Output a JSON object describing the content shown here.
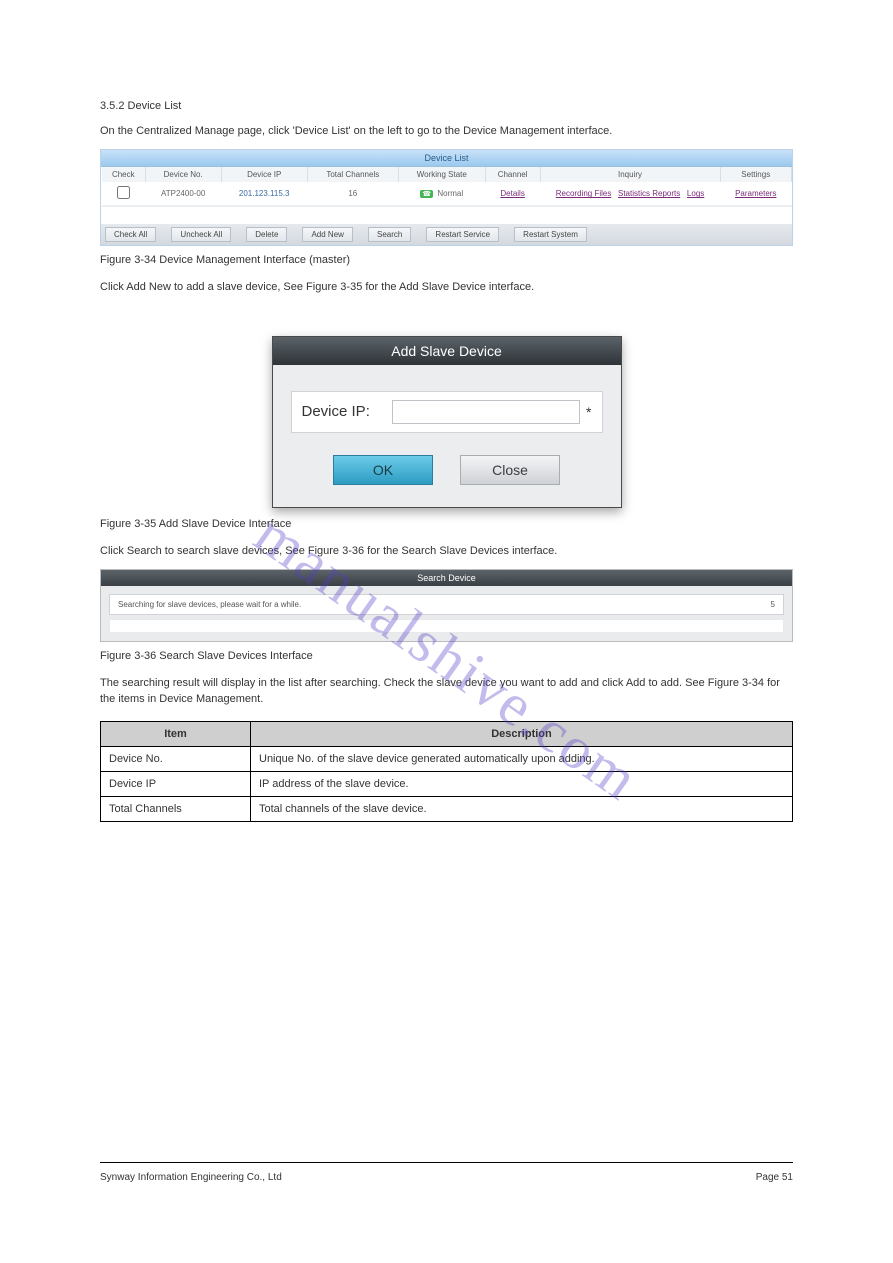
{
  "watermark": "manualshive.com",
  "heading_top": "3.5.2 Device List",
  "intro_text": "On the Centralized Manage page, click 'Device List' on the left to go to the Device Management interface.",
  "device_list": {
    "title": "Device List",
    "headers": [
      "Check",
      "Device No.",
      "Device IP",
      "Total Channels",
      "Working State",
      "Channel",
      "Inquiry",
      "Settings"
    ],
    "row": {
      "device_no": "ATP2400-00",
      "device_ip": "201.123.115.3",
      "total_channels": "16",
      "state_text": "Normal",
      "channel_link": "Details",
      "inquiry_files": "Recording Files",
      "inquiry_stats": "Statistics Reports",
      "inquiry_logs": "Logs",
      "settings_link": "Parameters"
    },
    "buttons": [
      "Check All",
      "Uncheck All",
      "Delete",
      "Add New",
      "Search",
      "Restart Service",
      "Restart System"
    ]
  },
  "fig1_caption": "Figure 3-34 Device Management Interface (master)",
  "add_new_text": "Click Add New to add a slave device, See Figure 3-35 for the Add Slave Device interface.",
  "dialog": {
    "title": "Add Slave Device",
    "label": "Device IP:",
    "star": "*",
    "ok": "OK",
    "close": "Close"
  },
  "fig2_caption": "Figure 3-35 Add Slave Device Interface",
  "search_text": "Click Search to search slave devices, See Figure 3-36 for the Search Slave Devices interface.",
  "search_panel": {
    "title": "Search Device",
    "body": "Searching for slave devices, please wait for a while.",
    "counter": "5"
  },
  "fig3_caption": "Figure 3-36 Search Slave Devices Interface",
  "result_text": "The searching result will display in the list after searching. Check the slave device you want to add and click Add to add. See Figure 3-34 for the items in Device Management.",
  "items_table": {
    "headers": [
      "Item",
      "Description"
    ],
    "rows": [
      [
        "Device No.",
        "Unique No. of the slave device generated automatically upon adding."
      ],
      [
        "Device IP",
        "IP address of the slave device."
      ],
      [
        "Total Channels",
        "Total channels of the slave device."
      ]
    ]
  },
  "footer": {
    "left": "Synway Information Engineering Co., Ltd",
    "right": "Page 51"
  }
}
